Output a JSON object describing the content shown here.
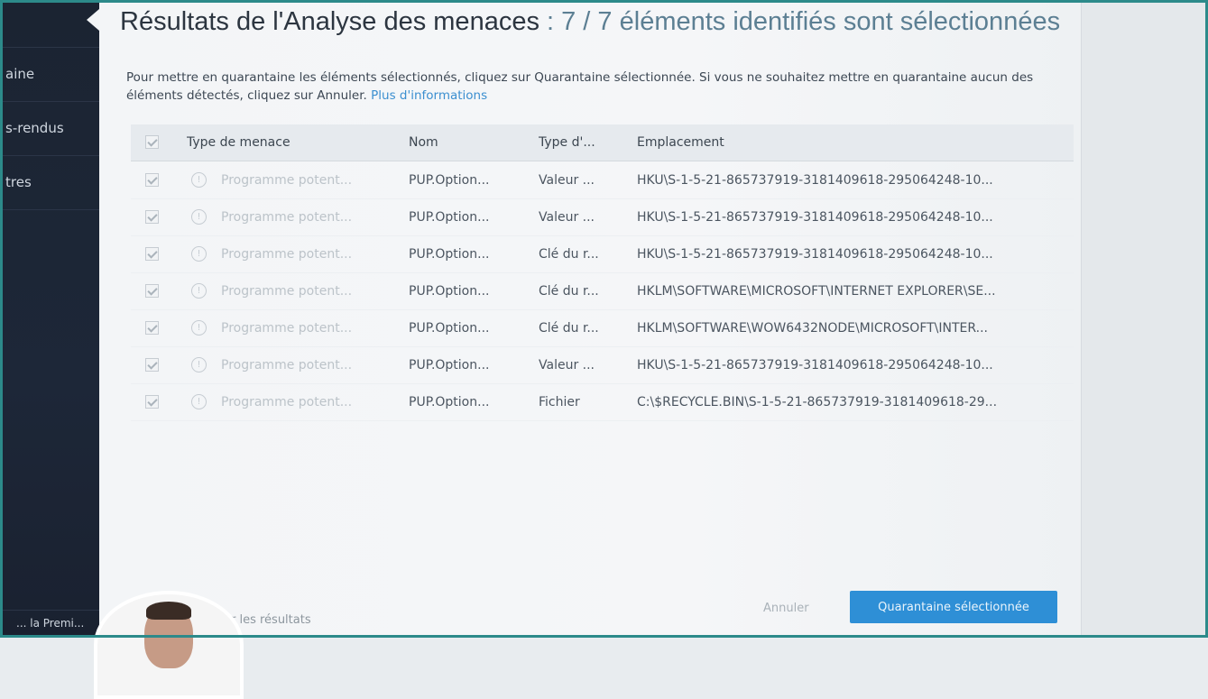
{
  "sidebar": {
    "items": [
      {
        "label": "aine"
      },
      {
        "label": "s-rendus"
      },
      {
        "label": "tres"
      }
    ],
    "bottom_label": "... la Premi..."
  },
  "header": {
    "title_main": "Résultats de l'Analyse des menaces",
    "title_sep": " : ",
    "title_count": "7 / 7",
    "title_suffix": " éléments identifiés sont sélectionnées"
  },
  "description": {
    "text": "Pour mettre en quarantaine les éléments sélectionnés, cliquez sur Quarantaine sélectionnée. Si vous ne souhaitez mettre en quarantaine aucun des éléments détectés, cliquez sur Annuler.",
    "more_link": "Plus d'informations"
  },
  "table": {
    "headers": {
      "type": "Type de menace",
      "name": "Nom",
      "objtype": "Type d'...",
      "location": "Emplacement"
    },
    "rows": [
      {
        "type": "Programme potent...",
        "name": "PUP.Option...",
        "objtype": "Valeur ...",
        "location": "HKU\\S-1-5-21-865737919-3181409618-295064248-10..."
      },
      {
        "type": "Programme potent...",
        "name": "PUP.Option...",
        "objtype": "Valeur ...",
        "location": "HKU\\S-1-5-21-865737919-3181409618-295064248-10..."
      },
      {
        "type": "Programme potent...",
        "name": "PUP.Option...",
        "objtype": "Clé du r...",
        "location": "HKU\\S-1-5-21-865737919-3181409618-295064248-10..."
      },
      {
        "type": "Programme potent...",
        "name": "PUP.Option...",
        "objtype": "Clé du r...",
        "location": "HKLM\\SOFTWARE\\MICROSOFT\\INTERNET EXPLORER\\SE..."
      },
      {
        "type": "Programme potent...",
        "name": "PUP.Option...",
        "objtype": "Clé du r...",
        "location": "HKLM\\SOFTWARE\\WOW6432NODE\\MICROSOFT\\INTER..."
      },
      {
        "type": "Programme potent...",
        "name": "PUP.Option...",
        "objtype": "Valeur ...",
        "location": "HKU\\S-1-5-21-865737919-3181409618-295064248-10..."
      },
      {
        "type": "Programme potent...",
        "name": "PUP.Option...",
        "objtype": "Fichier",
        "location": "C:\\$RECYCLE.BIN\\S-1-5-21-865737919-3181409618-29..."
      }
    ]
  },
  "footer": {
    "export_label": "r les résultats",
    "cancel_label": "Annuler",
    "quarantine_label": "Quarantaine sélectionnée"
  },
  "colors": {
    "accent": "#2e8fd6",
    "sidebar": "#1b2432",
    "frame": "#2c8a8a"
  },
  "icons": {
    "checkbox": "check-icon",
    "info": "info-icon",
    "avatar": "user-avatar"
  }
}
